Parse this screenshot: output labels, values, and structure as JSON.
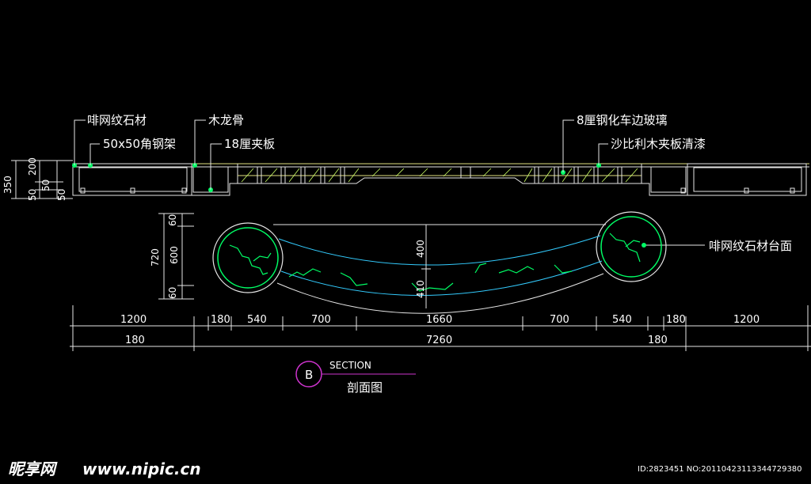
{
  "labels": {
    "stone_left": "啡网纹石材",
    "steel_frame": "50x50角钢架",
    "wood_keel": "木龙骨",
    "plywood": "18厘夹板",
    "glass": "8厘钢化车边玻璃",
    "sapele": "沙比利木夹板清漆",
    "stone_top": "啡网纹石材台面"
  },
  "dims_left": {
    "d350": "350",
    "d200": "200",
    "d50a": "50",
    "d50b": "50",
    "d50c": "50"
  },
  "dims_plan_left": {
    "d60a": "60",
    "d720": "720",
    "d600": "600",
    "d60b": "60"
  },
  "dims_center": {
    "d400": "400",
    "d410": "410"
  },
  "dims_row1": [
    "1200",
    "180",
    "540",
    "700",
    "1660",
    "700",
    "540",
    "180",
    "1200"
  ],
  "dims_row2": [
    "180",
    "7260",
    "180"
  ],
  "section": {
    "mark": "B",
    "word": "SECTION",
    "title": "剖面图"
  },
  "watermark": {
    "logo": "昵享网",
    "url": "www.nipic.cn",
    "id": "ID:2823451 NO:20110423113344729380"
  },
  "colors": {
    "bg": "#000000",
    "line": "#e6e6e6",
    "accent": "#00ff66",
    "cyan": "#33ccff",
    "hatch": "#ccff66",
    "magenta": "#cc33cc"
  }
}
